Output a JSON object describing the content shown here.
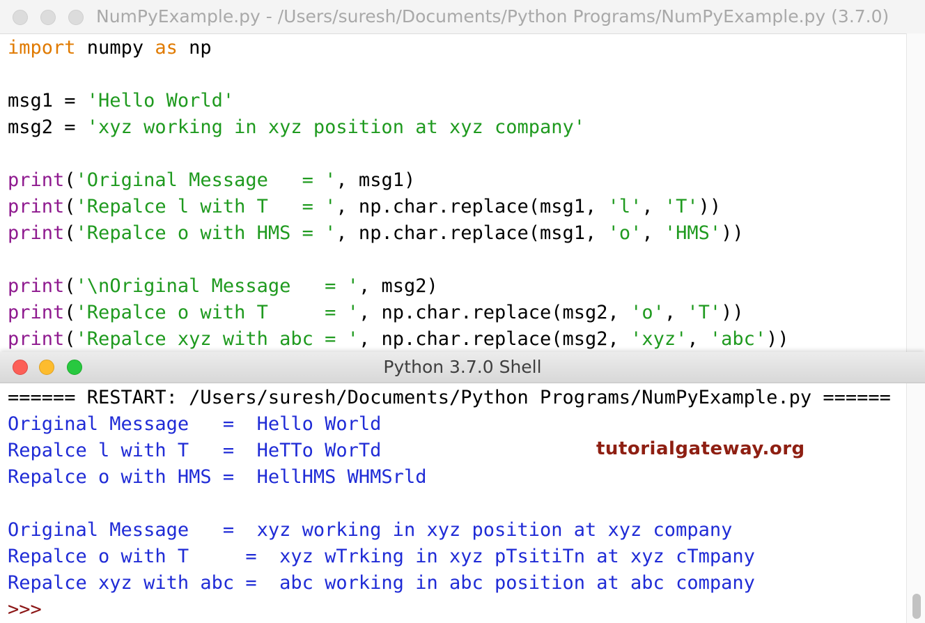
{
  "editor": {
    "title": "NumPyExample.py - /Users/suresh/Documents/Python Programs/NumPyExample.py (3.7.0)",
    "lines": [
      [
        {
          "t": "import",
          "c": "kw"
        },
        {
          "t": " numpy ",
          "c": ""
        },
        {
          "t": "as",
          "c": "kw"
        },
        {
          "t": " np",
          "c": ""
        }
      ],
      [],
      [
        {
          "t": "msg1 = ",
          "c": ""
        },
        {
          "t": "'Hello World'",
          "c": "str"
        }
      ],
      [
        {
          "t": "msg2 = ",
          "c": ""
        },
        {
          "t": "'xyz working in xyz position at xyz company'",
          "c": "str"
        }
      ],
      [],
      [
        {
          "t": "print",
          "c": "bi"
        },
        {
          "t": "(",
          "c": ""
        },
        {
          "t": "'Original Message   = '",
          "c": "str"
        },
        {
          "t": ", msg1)",
          "c": ""
        }
      ],
      [
        {
          "t": "print",
          "c": "bi"
        },
        {
          "t": "(",
          "c": ""
        },
        {
          "t": "'Repalce l with T   = '",
          "c": "str"
        },
        {
          "t": ", np.char.replace(msg1, ",
          "c": ""
        },
        {
          "t": "'l'",
          "c": "str"
        },
        {
          "t": ", ",
          "c": ""
        },
        {
          "t": "'T'",
          "c": "str"
        },
        {
          "t": "))",
          "c": ""
        }
      ],
      [
        {
          "t": "print",
          "c": "bi"
        },
        {
          "t": "(",
          "c": ""
        },
        {
          "t": "'Repalce o with HMS = '",
          "c": "str"
        },
        {
          "t": ", np.char.replace(msg1, ",
          "c": ""
        },
        {
          "t": "'o'",
          "c": "str"
        },
        {
          "t": ", ",
          "c": ""
        },
        {
          "t": "'HMS'",
          "c": "str"
        },
        {
          "t": "))",
          "c": ""
        }
      ],
      [],
      [
        {
          "t": "print",
          "c": "bi"
        },
        {
          "t": "(",
          "c": ""
        },
        {
          "t": "'\\nOriginal Message   = '",
          "c": "str"
        },
        {
          "t": ", msg2)",
          "c": ""
        }
      ],
      [
        {
          "t": "print",
          "c": "bi"
        },
        {
          "t": "(",
          "c": ""
        },
        {
          "t": "'Repalce o with T     = '",
          "c": "str"
        },
        {
          "t": ", np.char.replace(msg2, ",
          "c": ""
        },
        {
          "t": "'o'",
          "c": "str"
        },
        {
          "t": ", ",
          "c": ""
        },
        {
          "t": "'T'",
          "c": "str"
        },
        {
          "t": "))",
          "c": ""
        }
      ],
      [
        {
          "t": "print",
          "c": "bi"
        },
        {
          "t": "(",
          "c": ""
        },
        {
          "t": "'Repalce xyz with abc = '",
          "c": "str"
        },
        {
          "t": ", np.char.replace(msg2, ",
          "c": ""
        },
        {
          "t": "'xyz'",
          "c": "str"
        },
        {
          "t": ", ",
          "c": ""
        },
        {
          "t": "'abc'",
          "c": "str"
        },
        {
          "t": "))",
          "c": ""
        }
      ]
    ]
  },
  "shell": {
    "title": "Python 3.7.0 Shell",
    "restart_line": "====== RESTART: /Users/suresh/Documents/Python Programs/NumPyExample.py ======",
    "output_lines": [
      "Original Message   =  Hello World",
      "Repalce l with T   =  HeTTo WorTd",
      "Repalce o with HMS =  HellHMS WHMSrld",
      "",
      "Original Message   =  xyz working in xyz position at xyz company",
      "Repalce o with T     =  xyz wTrking in xyz pTsitiTn at xyz cTmpany",
      "Repalce xyz with abc =  abc working in abc position at abc company"
    ],
    "prompt": ">>>",
    "watermark": "tutorialgateway.org"
  },
  "colors": {
    "keyword": "#e07a00",
    "builtin": "#8f1a8f",
    "string": "#1f9a1f",
    "output": "#1f2bd6",
    "prompt": "#8b1515"
  }
}
